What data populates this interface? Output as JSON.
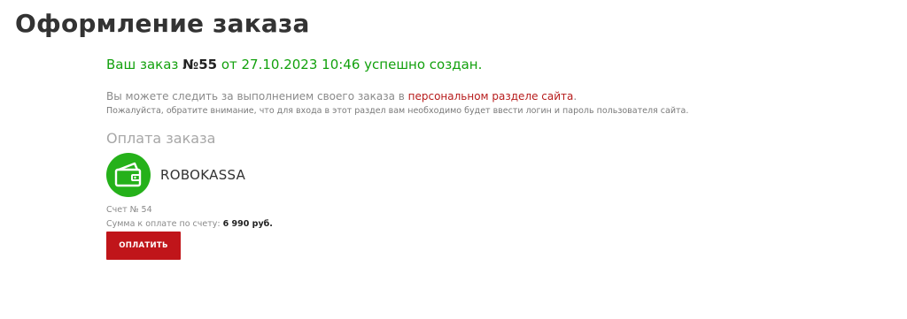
{
  "page": {
    "title": "Оформление заказа"
  },
  "order": {
    "prefix": "Ваш заказ ",
    "number": "№55",
    "suffix": " от 27.10.2023 10:46 успешно создан."
  },
  "tracking": {
    "text_before": "Вы можете следить за выполнением своего заказа в ",
    "link_text": "персональном разделе сайта",
    "text_after": ".",
    "note": "Пожалуйста, обратите внимание, что для входа в этот раздел вам необходимо будет ввести логин и пароль пользователя сайта."
  },
  "payment": {
    "section_title": "Оплата заказа",
    "system_name": "ROBOKASSA",
    "system_icon": "wallet-icon",
    "invoice_text": "Счет № 54",
    "sum_label": "Сумма к оплате по счету: ",
    "sum_value": "6 990 руб.",
    "pay_button_label": "ОПЛАТИТЬ"
  },
  "colors": {
    "success": "#13a10e",
    "link": "#b71c1c",
    "button": "#c0151a",
    "icon_bg": "#25b11a"
  }
}
